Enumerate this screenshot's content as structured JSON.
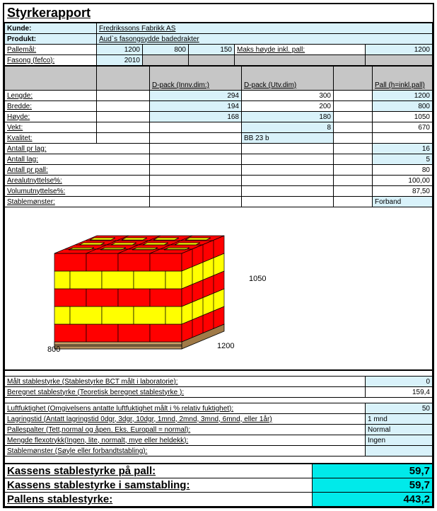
{
  "title": "Styrkerapport",
  "header": {
    "kunde_label": "Kunde:",
    "kunde_value": "Fredrikssons Fabrikk AS",
    "produkt_label": "Produkt:",
    "produkt_value": "Aud`s fasongsydde badedrakter",
    "pallemal_label": "Pallemål:",
    "pallemal_v1": "1200",
    "pallemal_v2": "800",
    "pallemal_v3": "150",
    "makshoyde_label": "Maks høyde inkl. pall:",
    "makshoyde_value": "1200",
    "fasong_label": "Fasong (fefco):",
    "fasong_value": "2010"
  },
  "colheaders": {
    "dpack_innv": "D-pack (Innv.dim:)",
    "dpack_utv": "D-pack (Utv.dim)",
    "pall": "Pall (h=inkl.pall)"
  },
  "rows": {
    "lengde": {
      "label": "Lengde:",
      "innv": "294",
      "utv": "300",
      "pall": "1200"
    },
    "bredde": {
      "label": "Bredde:",
      "innv": "194",
      "utv": "200",
      "pall": "800"
    },
    "hoyde": {
      "label": "Høyde:",
      "innv": "168",
      "utv": "180",
      "pall": "1050"
    },
    "vekt": {
      "label": "Vekt:",
      "innv": "",
      "utv": "8",
      "pall": "670"
    },
    "kvalitet": {
      "label": "Kvalitet:",
      "utv": "BB 23 b"
    },
    "antall_pr_lag": {
      "label": "Antall pr lag:",
      "pall": "16"
    },
    "antall_lag": {
      "label": "Antall lag:",
      "pall": "5"
    },
    "antall_pr_pall": {
      "label": "Antall pr pall:",
      "pall": "80"
    },
    "arealutn": {
      "label": "Arealutnyttelse%:",
      "pall": "100,00"
    },
    "volumutn": {
      "label": "Volumutnyttelse%:",
      "pall": "87,50"
    },
    "stablemonster": {
      "label": "Stablemønster:",
      "pall": "Forband"
    }
  },
  "pallet_dims": {
    "h": "1050",
    "l": "1200",
    "w": "800"
  },
  "measurements": {
    "malt": {
      "label": "Målt stablestyrke (Stablestyrke BCT målt i laboratorie):",
      "value": "0"
    },
    "beregnet": {
      "label": "Beregnet stablestyrke (Teoretisk beregnet stablestyrke ):",
      "value": "159,4"
    },
    "luftfukt": {
      "label": "Luftfuktighet (Omgivelsens antatte luftfuktighet målt i % relativ fuktighet):",
      "value": "50"
    },
    "lagringstid": {
      "label": "Lagringstid (Antatt lagringstid 0dgr, 3dgr, 10dgr, 1mnd, 2mnd, 3mnd, 6mnd, eller 1år)",
      "value": "1 mnd"
    },
    "pallespalter": {
      "label": "Pallespalter (Tett,normal og åpen. Eks. Europall = normal):",
      "value": "Normal"
    },
    "flexotrykk": {
      "label": "Mengde flexotrykk(Ingen, lite, normalt, mye eller heldekk):",
      "value": "Ingen"
    },
    "stablemonster2": {
      "label": "Stablemønster (Søyle eller forbandtstabling):",
      "value": ""
    }
  },
  "results": {
    "r1": {
      "label": "Kassens stablestyrke på pall:",
      "value": "59,7"
    },
    "r2": {
      "label": "Kassens stablestyrke i samstabling:",
      "value": "59,7"
    },
    "r3": {
      "label": "Pallens stablestyrke:",
      "value": "443,2"
    }
  }
}
